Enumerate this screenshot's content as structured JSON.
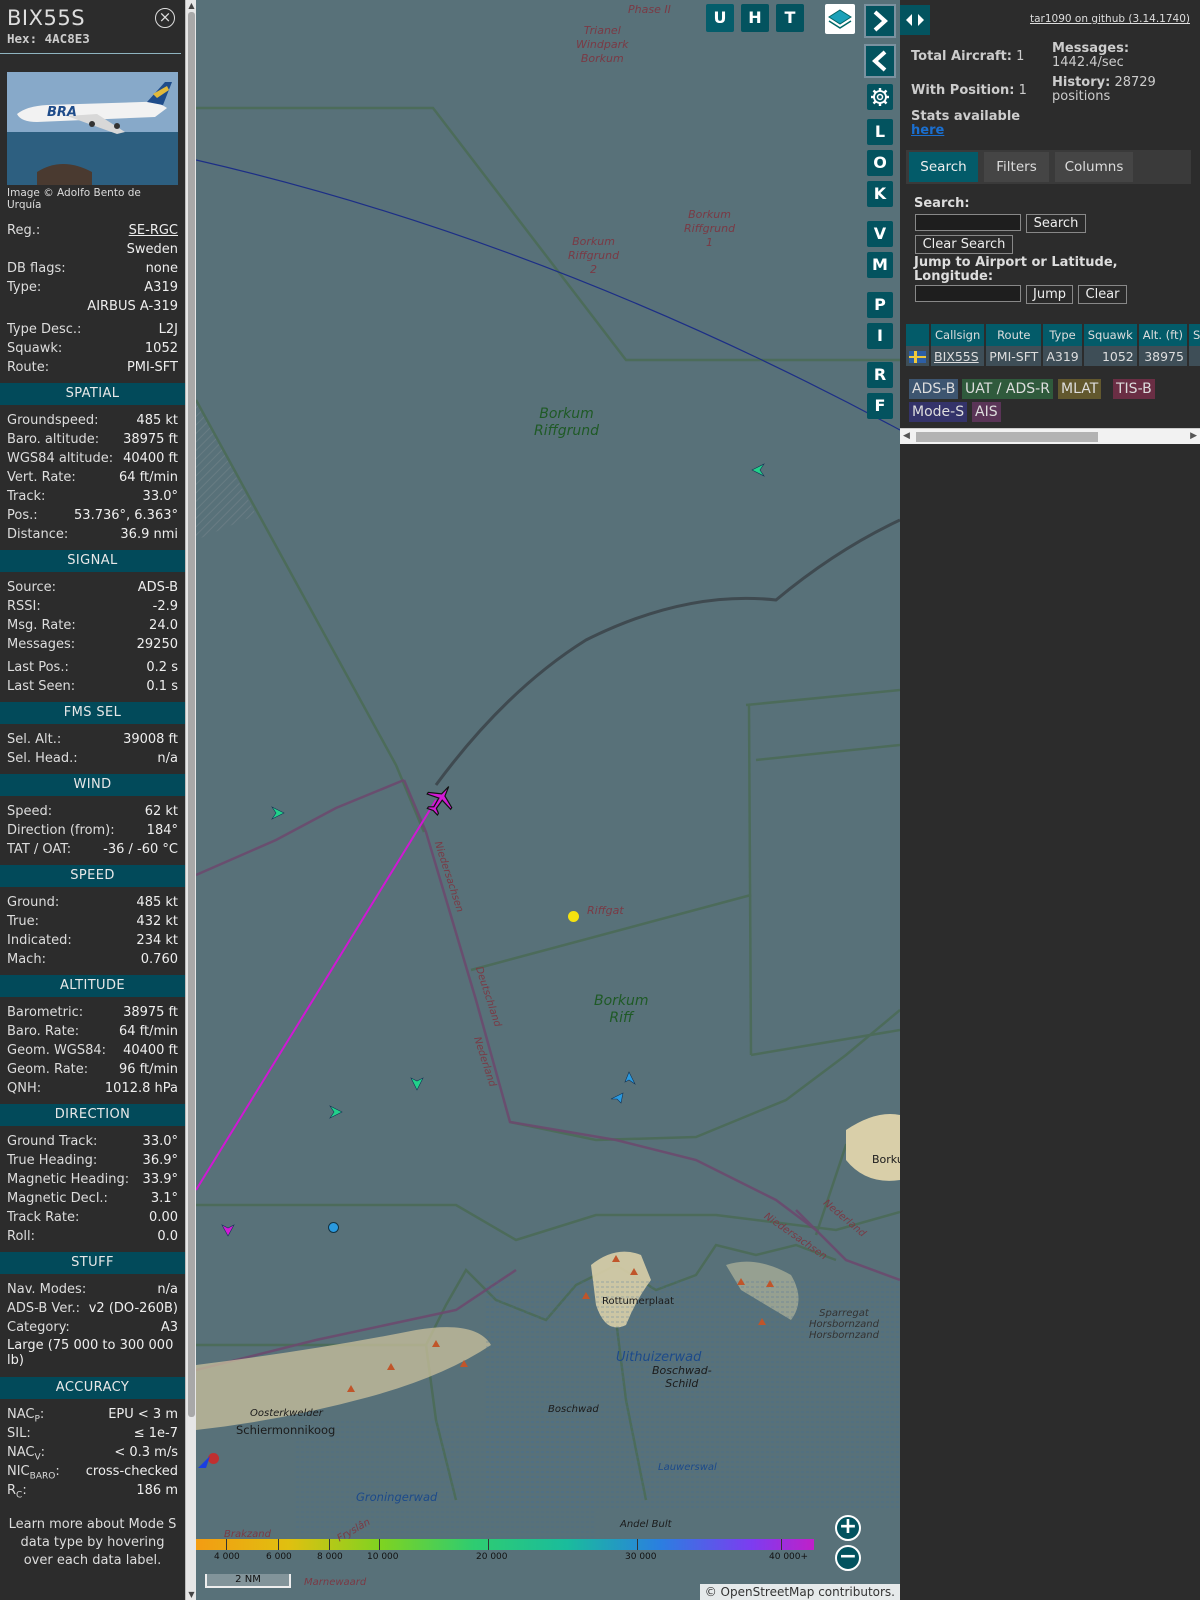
{
  "aircraft": {
    "callsign": "BIX55S",
    "hex_label": "Hex: 4AC8E3",
    "photo_credit": "Image © Adolfo Bento de Urquía",
    "header_rows": [
      {
        "label": "Reg.:",
        "value": "SE-RGC"
      },
      {
        "label": "",
        "value": "Sweden"
      },
      {
        "label": "DB flags:",
        "value": "none"
      },
      {
        "label": "Type:",
        "value": "A319"
      },
      {
        "label": "",
        "value": "AIRBUS A-319"
      }
    ],
    "type_rows": [
      {
        "label": "Type Desc.:",
        "value": "L2J"
      },
      {
        "label": "Squawk:",
        "value": "1052"
      },
      {
        "label": "Route:",
        "value": "PMI-SFT"
      }
    ]
  },
  "sections": {
    "spatial": {
      "title": "SPATIAL",
      "rows": [
        {
          "label": "Groundspeed:",
          "value": "485 kt"
        },
        {
          "label": "Baro. altitude:",
          "value": "38975 ft"
        },
        {
          "label": "WGS84 altitude:",
          "value": "40400 ft"
        },
        {
          "label": "Vert. Rate:",
          "value": "64 ft/min"
        },
        {
          "label": "Track:",
          "value": "33.0°"
        },
        {
          "label": "Pos.:",
          "value": "53.736°, 6.363°"
        },
        {
          "label": "Distance:",
          "value": "36.9 nmi"
        }
      ]
    },
    "signal": {
      "title": "SIGNAL",
      "rows": [
        {
          "label": "Source:",
          "value": "ADS-B"
        },
        {
          "label": "RSSI:",
          "value": "-2.9"
        },
        {
          "label": "Msg. Rate:",
          "value": "24.0"
        },
        {
          "label": "Messages:",
          "value": "29250"
        }
      ],
      "rows2": [
        {
          "label": "Last Pos.:",
          "value": "0.2 s"
        },
        {
          "label": "Last Seen:",
          "value": "0.1 s"
        }
      ]
    },
    "fms": {
      "title": "FMS SEL",
      "rows": [
        {
          "label": "Sel. Alt.:",
          "value": "39008 ft"
        },
        {
          "label": "Sel. Head.:",
          "value": "n/a"
        }
      ]
    },
    "wind": {
      "title": "WIND",
      "rows": [
        {
          "label": "Speed:",
          "value": "62 kt"
        },
        {
          "label": "Direction (from):",
          "value": "184°"
        },
        {
          "label": "TAT / OAT:",
          "value": "-36 / -60 °C"
        }
      ]
    },
    "speed": {
      "title": "SPEED",
      "rows": [
        {
          "label": "Ground:",
          "value": "485 kt"
        },
        {
          "label": "True:",
          "value": "432 kt"
        },
        {
          "label": "Indicated:",
          "value": "234 kt"
        },
        {
          "label": "Mach:",
          "value": "0.760"
        }
      ]
    },
    "altitude": {
      "title": "ALTITUDE",
      "rows": [
        {
          "label": "Barometric:",
          "value": "38975 ft"
        },
        {
          "label": "Baro. Rate:",
          "value": "64 ft/min"
        },
        {
          "label": "Geom. WGS84:",
          "value": "40400 ft"
        },
        {
          "label": "Geom. Rate:",
          "value": "96 ft/min"
        },
        {
          "label": "QNH:",
          "value": "1012.8 hPa"
        }
      ]
    },
    "direction": {
      "title": "DIRECTION",
      "rows": [
        {
          "label": "Ground Track:",
          "value": "33.0°"
        },
        {
          "label": "True Heading:",
          "value": "36.9°"
        },
        {
          "label": "Magnetic Heading:",
          "value": "33.9°"
        },
        {
          "label": "Magnetic Decl.:",
          "value": "3.1°"
        },
        {
          "label": "Track Rate:",
          "value": "0.00"
        },
        {
          "label": "Roll:",
          "value": "0.0"
        }
      ]
    },
    "stuff": {
      "title": "STUFF",
      "rows": [
        {
          "label": "Nav. Modes:",
          "value": "n/a"
        },
        {
          "label": "ADS-B Ver.:",
          "value": "v2 (DO-260B)"
        },
        {
          "label": "Category:",
          "value": "A3"
        }
      ],
      "category_desc": "Large (75 000 to 300 000 lb)"
    },
    "accuracy": {
      "title": "ACCURACY",
      "rows": [
        {
          "label": "NAC",
          "sub": "P",
          "after": ":",
          "value": "EPU < 3 m"
        },
        {
          "label": "SIL:",
          "sub": "",
          "after": "",
          "value": "≤ 1e-7"
        },
        {
          "label": "NAC",
          "sub": "V",
          "after": ":",
          "value": "< 0.3 m/s"
        },
        {
          "label": "NIC",
          "sub": "BARO",
          "after": ":",
          "value": "cross-checked"
        },
        {
          "label": "R",
          "sub": "C",
          "after": ":",
          "value": "186 m"
        }
      ]
    },
    "footer": "Learn more about Mode S data type by hovering over each data label."
  },
  "map": {
    "top_buttons": [
      "U",
      "H",
      "T"
    ],
    "side_buttons": [
      "L",
      "O",
      "K",
      "V",
      "M",
      "P",
      "I",
      "R",
      "F"
    ],
    "labels": {
      "phase2": "Phase II",
      "trianel": "Trianel\nWindpark\nBorkum",
      "riffgrund1": "Borkum\nRiffgrund\n1",
      "riffgrund2": "Borkum\nRiffgrund\n2",
      "riffgrund": "Borkum\nRiffgrund",
      "riffgat": "Riffgat",
      "borkumriff": "Borkum\nRiff",
      "niedersachsen": "Niedersachsen",
      "deutschland": "Deutschland",
      "nederland": "Nederland",
      "nederland2": "Nederland",
      "niedersachsen2": "Niedersachsen",
      "rottumerplaat": "Rottumerplaat",
      "uithuizerwad": "Uithuizerwad",
      "boschwadschild": "Boschwad-\nSchild",
      "boschwad": "Boschwad",
      "sparregat": "Sparregat\nHorsbornzand\nHorsbornzand",
      "oosterkwelder": "Oosterkwelder",
      "schiermonnikoog": "Schiermonnikoog",
      "lauwerswal": "Lauwerswal",
      "groningerwad": "Groningerwad",
      "andelbult": "Andel Bult",
      "friesland": "Fryslân",
      "brakzand": "Brakzand",
      "marnewaard": "Marnewaard",
      "borkum": "Borku"
    },
    "altitude_scale": [
      "4 000",
      "6 000",
      "8 000",
      "10 000",
      "20 000",
      "30 000",
      "40 000+"
    ],
    "scale_bar": "2 NM",
    "attribution_symbol": "©",
    "attribution_link": "OpenStreetMap",
    "attribution_text": "contributors."
  },
  "sidebar": {
    "github_link": "tar1090 on github (3.14.1740)",
    "total_aircraft_label": "Total Aircraft:",
    "total_aircraft": "1",
    "with_position_label": "With Position:",
    "with_position": "1",
    "messages_label": "Messages:",
    "messages_rate": "1442.4/sec",
    "history_label": "History:",
    "history_value": "28729 positions",
    "stats_label": "Stats available",
    "stats_link": "here",
    "tabs": [
      "Search",
      "Filters",
      "Columns"
    ],
    "search_label": "Search:",
    "search_button": "Search",
    "clear_search_button": "Clear Search",
    "jump_label": "Jump to Airport or Latitude, Longitude:",
    "jump_button": "Jump",
    "clear_button": "Clear",
    "table_headers": [
      "",
      "Callsign",
      "Route",
      "Type",
      "Squawk",
      "Alt. (ft)",
      "Sp"
    ],
    "table_rows": [
      {
        "callsign": "BIX55S",
        "route": "PMI-SFT",
        "type": "A319",
        "squawk": "1052",
        "alt": "38975",
        "speed": ""
      }
    ],
    "legend": [
      {
        "label": "ADS-B",
        "color": "#3d5570"
      },
      {
        "label": "UAT / ADS-R",
        "color": "#2f5a3c"
      },
      {
        "label": "MLAT",
        "color": "#62582e"
      },
      {
        "label": "TIS-B",
        "color": "#6a2e44"
      },
      {
        "label": "Mode-S",
        "color": "#34336a"
      },
      {
        "label": "AIS",
        "color": "#5a3457"
      }
    ]
  }
}
